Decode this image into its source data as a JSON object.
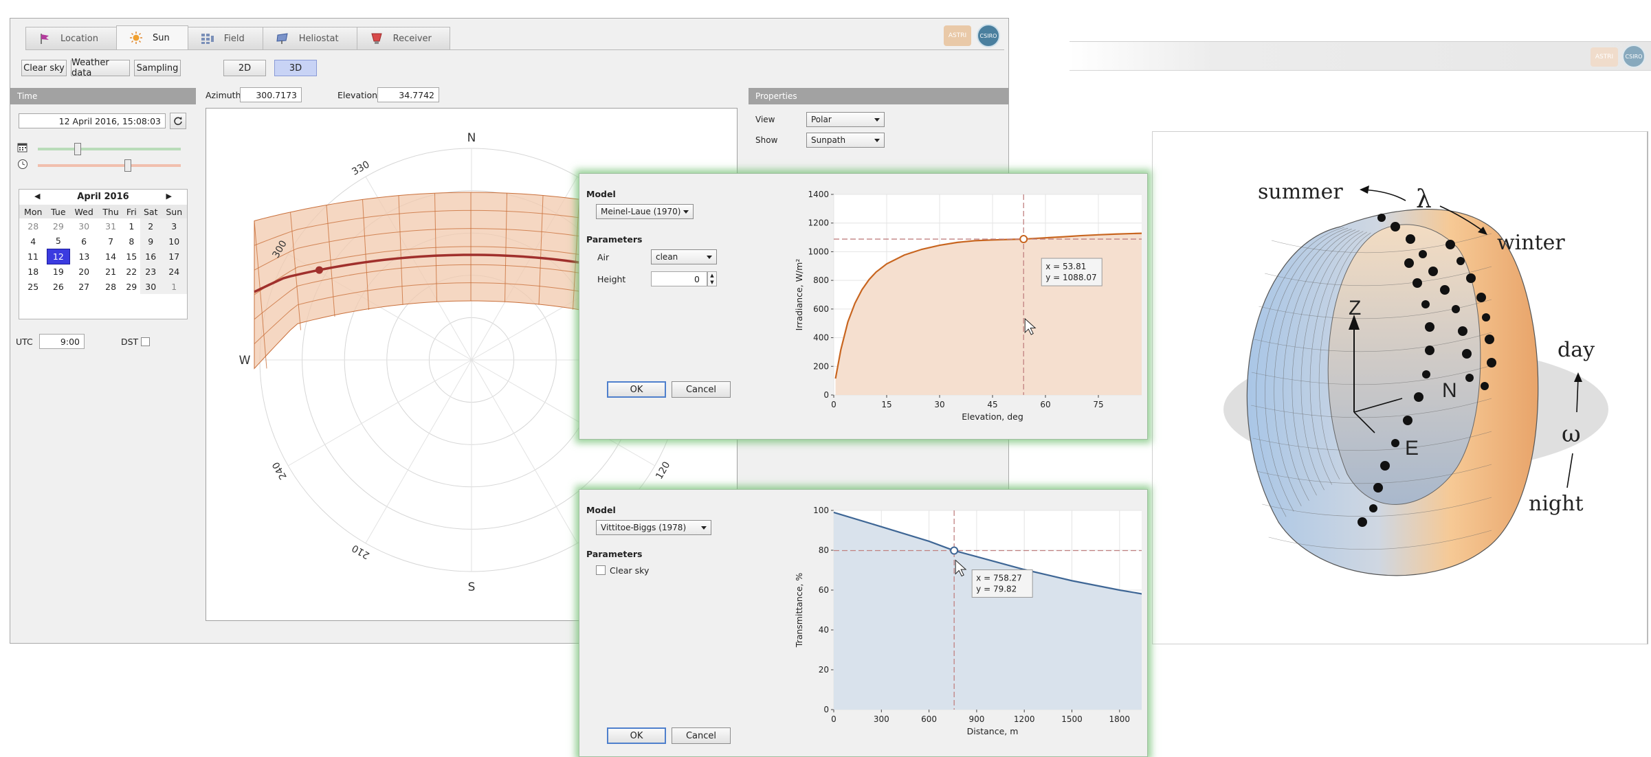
{
  "tabs": [
    {
      "label": "Location",
      "icon": "flag-icon"
    },
    {
      "label": "Sun",
      "icon": "sun-icon",
      "active": true
    },
    {
      "label": "Field",
      "icon": "field-icon"
    },
    {
      "label": "Heliostat",
      "icon": "heliostat-icon"
    },
    {
      "label": "Receiver",
      "icon": "receiver-icon"
    }
  ],
  "logos": {
    "badge1": "ASTRI",
    "badge2": "CSIRO"
  },
  "toolbar": {
    "clear_sky": "Clear sky",
    "weather_data": "Weather data",
    "sampling": "Sampling",
    "mode_2d": "2D",
    "mode_3d": "3D",
    "active_mode": "3D"
  },
  "time_panel": {
    "header": "Time",
    "datetime": "12 April 2016, 15:08:03",
    "calendar": {
      "month_label": "April 2016",
      "weekdays": [
        "Mon",
        "Tue",
        "Wed",
        "Thu",
        "Fri",
        "Sat",
        "Sun"
      ],
      "weeks": [
        [
          "28",
          "29",
          "30",
          "31",
          "1",
          "2",
          "3"
        ],
        [
          "4",
          "5",
          "6",
          "7",
          "8",
          "9",
          "10"
        ],
        [
          "11",
          "12",
          "13",
          "14",
          "15",
          "16",
          "17"
        ],
        [
          "18",
          "19",
          "20",
          "21",
          "22",
          "23",
          "24"
        ],
        [
          "25",
          "26",
          "27",
          "28",
          "29",
          "30",
          "1"
        ]
      ],
      "selected": "12"
    },
    "utc_label": "UTC",
    "utc_value": "9:00",
    "dst_label": "DST",
    "date_slider_fraction": 0.28,
    "time_slider_fraction": 0.63
  },
  "sun_position": {
    "azimuth_label": "Azimuth",
    "azimuth": "300.7173",
    "elevation_label": "Elevation",
    "elevation": "34.7742"
  },
  "properties": {
    "header": "Properties",
    "view_label": "View",
    "view_value": "Polar",
    "show_label": "Show",
    "show_value": "Sunpath"
  },
  "polar_plot": {
    "cardinals": {
      "n": "N",
      "s": "S",
      "w": "W"
    },
    "angle_labels": [
      {
        "text": "330",
        "angle": 330
      },
      {
        "text": "300",
        "angle": 300
      },
      {
        "text": "240",
        "angle": 240
      },
      {
        "text": "210",
        "angle": 210
      },
      {
        "text": "120",
        "angle": 120
      }
    ],
    "colors": {
      "band": "#f2c9ae",
      "band_stroke": "#c96f3a",
      "sunpath": "#a0302c"
    }
  },
  "irradiance_dialog": {
    "model_label": "Model",
    "model_value": "Meinel-Laue (1970)",
    "parameters_label": "Parameters",
    "air_label": "Air",
    "air_value": "clean",
    "height_label": "Height",
    "height_value": "0",
    "ok": "OK",
    "cancel": "Cancel",
    "tooltip_x": "x = 53.81",
    "tooltip_y": "y = 1088.07"
  },
  "transmittance_dialog": {
    "model_label": "Model",
    "model_value": "Vittitoe-Biggs (1978)",
    "parameters_label": "Parameters",
    "clear_sky_label": "Clear sky",
    "ok": "OK",
    "cancel": "Cancel",
    "tooltip_x": "x = 758.27",
    "tooltip_y": "y = 79.82"
  },
  "chart_data": [
    {
      "type": "area",
      "xlabel": "Elevation, deg",
      "ylabel": "Irradiance, W/m²",
      "xlim": [
        0,
        90
      ],
      "ylim": [
        0,
        1400
      ],
      "xticks": [
        "0",
        "15",
        "30",
        "45",
        "60",
        "75",
        "90"
      ],
      "yticks": [
        "0",
        "200",
        "400",
        "600",
        "800",
        "1000",
        "1200",
        "1400"
      ],
      "x": [
        0.5,
        2,
        4,
        6,
        8,
        10,
        12,
        15,
        20,
        25,
        30,
        35,
        40,
        45,
        50,
        53.81,
        60,
        65,
        70,
        75,
        80,
        85,
        90
      ],
      "y": [
        115,
        315,
        510,
        640,
        735,
        805,
        858,
        915,
        977,
        1017,
        1045,
        1065,
        1077,
        1082,
        1086,
        1088,
        1097,
        1104,
        1112,
        1118,
        1123,
        1127,
        1130
      ],
      "marker": {
        "x": 53.81,
        "y": 1088.07
      },
      "colors": {
        "line": "#c8651f",
        "fill": "#f5dfcf"
      }
    },
    {
      "type": "area",
      "xlabel": "Distance, m",
      "ylabel": "Transmittance, %",
      "xlim": [
        0,
        2000
      ],
      "ylim": [
        0,
        100
      ],
      "xticks": [
        "0",
        "300",
        "600",
        "900",
        "1200",
        "1500",
        "1800"
      ],
      "yticks": [
        "0",
        "20",
        "40",
        "60",
        "80",
        "100"
      ],
      "x": [
        0,
        300,
        600,
        758.27,
        900,
        1200,
        1500,
        1800,
        2000
      ],
      "y": [
        99,
        91.8,
        84.5,
        79.82,
        76.8,
        70.3,
        64.7,
        60.0,
        57.3
      ],
      "marker": {
        "x": 758.27,
        "y": 79.82
      },
      "colors": {
        "line": "#3e6695",
        "fill": "#d9e2ec"
      }
    }
  ],
  "torus_figure": {
    "labels": {
      "summer": "summer",
      "lambda": "λ",
      "winter": "winter",
      "day": "day",
      "omega": "ω",
      "night": "night",
      "z": "Z",
      "n": "N",
      "e": "E"
    },
    "colors": {
      "warm": "#f6c995",
      "cool": "#a9c6e6",
      "disc": "#d9d9d9"
    }
  }
}
